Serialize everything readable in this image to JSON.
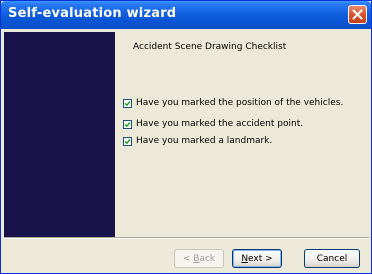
{
  "window": {
    "title": "Self-evaluation wizard"
  },
  "content": {
    "heading": "Accident Scene Drawing Checklist",
    "items": [
      {
        "label": "Have you marked the position of the vehicles.",
        "checked": true
      },
      {
        "label": "Have you marked the accident point.",
        "checked": true
      },
      {
        "label": "Have you marked a landmark.",
        "checked": true
      }
    ]
  },
  "buttons": {
    "back": {
      "prefix": "< ",
      "mnemonic": "B",
      "rest": "ack"
    },
    "next": {
      "mnemonic": "N",
      "rest": "ext >"
    },
    "cancel": "Cancel"
  },
  "colors": {
    "titlebar": "#0a55d5",
    "sidepanel": "#17134a",
    "checkmark": "#21a121",
    "face": "#ece9d8"
  }
}
